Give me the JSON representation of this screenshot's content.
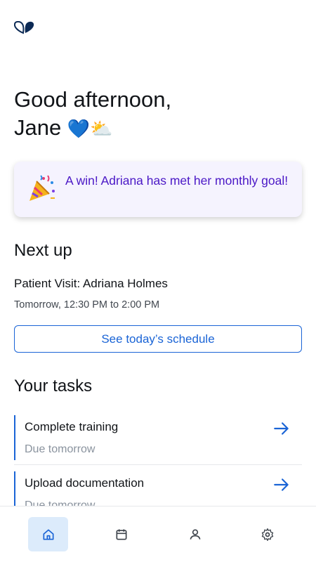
{
  "greeting": {
    "line1": "Good afternoon,",
    "name": "Jane",
    "emoji": "💙⛅"
  },
  "win_card": {
    "icon": "party-popper-icon",
    "text": "A win! Adriana has met her monthly goal!"
  },
  "next_up": {
    "title": "Next up",
    "visit_title": "Patient Visit: Adriana Holmes",
    "visit_time": "Tomorrow, 12:30 PM to 2:00 PM",
    "schedule_button": "See today’s schedule"
  },
  "tasks": {
    "title": "Your tasks",
    "items": [
      {
        "name": "Complete training",
        "due": "Due tomorrow"
      },
      {
        "name": "Upload documentation",
        "due": "Due tomorrow"
      }
    ]
  },
  "nav": {
    "items": [
      "home-icon",
      "calendar-icon",
      "profile-icon",
      "settings-icon"
    ],
    "active": "home-icon"
  },
  "colors": {
    "accent": "#1a64d6",
    "win_text": "#4a17c6",
    "win_bg": "#f5f3fe",
    "logo": "#0c2a55"
  }
}
